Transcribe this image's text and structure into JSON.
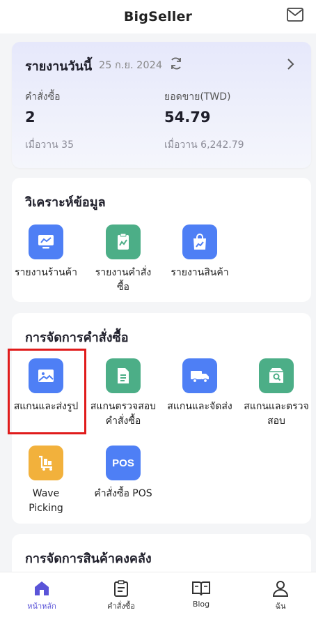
{
  "header": {
    "title": "BigSeller",
    "mail_icon": "mail-icon"
  },
  "report": {
    "title": "รายงานวันนี้",
    "date": "25 ก.ย. 2024",
    "orders_label": "คำสั่งซื้อ",
    "orders_value": "2",
    "orders_prev": "เมื่อวาน 35",
    "sales_label": "ยอดขาย(TWD)",
    "sales_value": "54.79",
    "sales_prev": "เมื่อวาน 6,242.79"
  },
  "analysis": {
    "title": "วิเคราะห์ข้อมูล",
    "items": [
      {
        "label": "รายงานร้านค้า",
        "icon": "monitor-chart-icon",
        "color": "#4e7ff5"
      },
      {
        "label": "รายงานคำสั่งซื้อ",
        "icon": "clipboard-chart-icon",
        "color": "#4cae87"
      },
      {
        "label": "รายงานสินค้า",
        "icon": "shopping-bag-chart-icon",
        "color": "#4e7ff5"
      }
    ]
  },
  "order_mgmt": {
    "title": "การจัดการคำสั่งซื้อ",
    "items": [
      {
        "label": "สแกนและส่งรูป",
        "icon": "image-icon",
        "color": "#4e7ff5"
      },
      {
        "label": "สแกนตรวจสอบคำสั่งซื้อ",
        "icon": "document-list-icon",
        "color": "#4cae87"
      },
      {
        "label": "สแกนและจัดส่ง",
        "icon": "truck-icon",
        "color": "#4e7ff5"
      },
      {
        "label": "สแกนและตรวจสอบ",
        "icon": "box-search-icon",
        "color": "#4cae87"
      },
      {
        "label": "Wave Picking",
        "icon": "cart-icon",
        "color": "#f2b13c"
      },
      {
        "label": "คำสั่งซื้อ POS",
        "icon_text": "POS",
        "icon": "pos-icon",
        "color": "#4e7ff5"
      }
    ]
  },
  "inventory": {
    "title": "การจัดการสินค้าคงคลัง"
  },
  "bottom_nav": {
    "items": [
      {
        "label": "หน้าหลัก",
        "icon": "home-icon",
        "active": true
      },
      {
        "label": "คำสั่งซื้อ",
        "icon": "clipboard-icon"
      },
      {
        "label": "Blog",
        "icon": "book-icon"
      },
      {
        "label": "ฉัน",
        "icon": "user-icon"
      }
    ]
  },
  "colors": {
    "accent": "#5a54d8",
    "blue": "#4e7ff5",
    "green": "#4cae87",
    "orange": "#f2b13c",
    "highlight": "#e01b1b"
  }
}
